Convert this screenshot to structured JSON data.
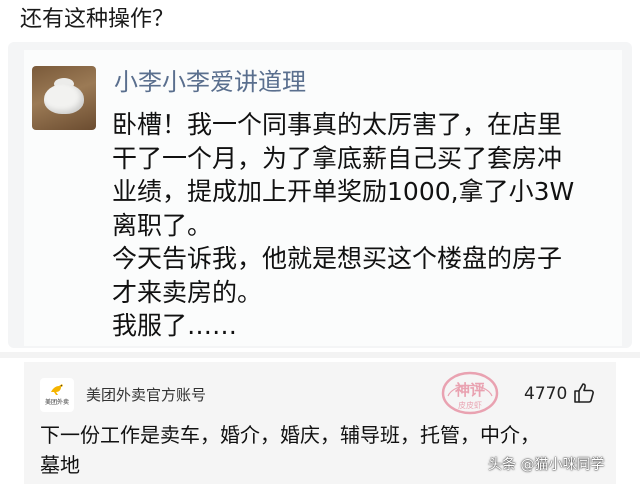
{
  "title": "还有这种操作？",
  "post": {
    "author": "小李小李爱讲道理",
    "lines": [
      "卧槽！我一个同事真的太厉害了，在店里",
      "干了一个月，为了拿底薪自己买了套房冲",
      "业绩，提成加上开单奖励1000,拿了小3W",
      "离职了。",
      "今天告诉我，他就是想买这个楼盘的房子",
      "才来卖房的。",
      "我服了……"
    ]
  },
  "comment": {
    "author": "美团外卖官方账号",
    "likes": "4770",
    "lines": [
      "下一份工作是卖车，婚介，婚庆，辅导班，托管，中介，",
      "墓地"
    ],
    "logo_text": "美团外卖"
  },
  "watermarks": {
    "stamp_top": "神评",
    "stamp_bottom": "皮皮虾",
    "source": "头条 @猫小咪同学"
  },
  "colors": {
    "author_name": "#5a6f8e",
    "stamp": "#e0607a",
    "logo_yellow": "#f5b400"
  }
}
